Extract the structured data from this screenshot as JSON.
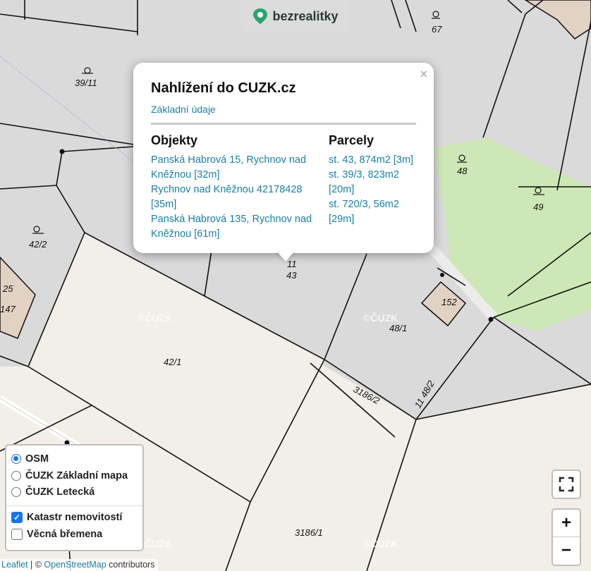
{
  "brand": {
    "name": "bezrealitky",
    "icon": "location-pin-icon"
  },
  "popup": {
    "title": "Nahlížení do CUZK.cz",
    "link": "Základní údaje",
    "objects_header": "Objekty",
    "parcels_header": "Parcely",
    "objects": [
      "Panská Habrová 15, Rychnov nad Kněžnou [32m]",
      "Rychnov nad Kněžnou 42178428 [35m]",
      "Panská Habrová 135, Rychnov nad Kněžnou [61m]"
    ],
    "parcels": [
      "st. 43, 874m2 [3m]",
      "st. 39/3, 823m2 [20m]",
      "st. 720/3, 56m2 [29m]"
    ],
    "close": "×"
  },
  "map_labels": {
    "l1": "67",
    "l2": "39/11",
    "l3": "48",
    "l4": "49",
    "l5": "42/2",
    "l6": "43",
    "l7": "152",
    "l8": "48/1",
    "l9": "147",
    "l10": "42/1",
    "l11": "3186/2",
    "l12": "11 48/2",
    "l13": "3186/1",
    "l14": "25",
    "l15": "11"
  },
  "watermark": "©ČUZK",
  "layers": {
    "base": [
      {
        "label": "OSM",
        "selected": true
      },
      {
        "label": "ČUZK Základní mapa",
        "selected": false
      },
      {
        "label": "ČUZK Letecká",
        "selected": false
      }
    ],
    "overlays": [
      {
        "label": "Katastr nemovitostí",
        "checked": true
      },
      {
        "label": "Věcná břemena",
        "checked": false
      }
    ]
  },
  "zoom": {
    "in": "+",
    "out": "−"
  },
  "attribution": {
    "leaflet": "Leaflet",
    "sep": " | © ",
    "osm": "OpenStreetMap",
    "suffix": " contributors"
  },
  "colors": {
    "accent": "#1a7fa6",
    "green": "#cde8b6",
    "parcel": "#dadada",
    "land": "#f2efe9"
  }
}
